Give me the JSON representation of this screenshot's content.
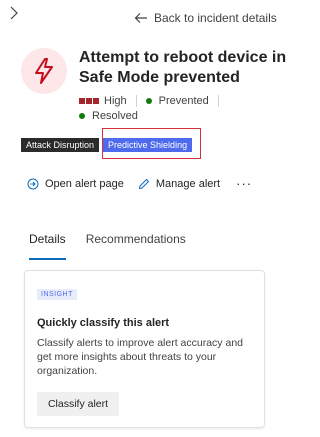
{
  "nav": {
    "back_label": "Back to incident details"
  },
  "alert": {
    "title": "Attempt to reboot device in Safe Mode prevented",
    "severity": "High",
    "status": "Prevented",
    "classification": "Resolved",
    "icon": "bolt-alert-icon"
  },
  "tags": [
    "Attack Disruption",
    "Predictive Shielding"
  ],
  "actions": {
    "open_label": "Open alert page",
    "manage_label": "Manage alert",
    "more_label": "···"
  },
  "tabs": [
    "Details",
    "Recommendations"
  ],
  "insight": {
    "badge": "INSIGHT",
    "title": "Quickly classify this alert",
    "body": "Classify alerts to improve alert accuracy and get more insights about threats to your organization.",
    "button": "Classify alert"
  },
  "colors": {
    "severity": "#a4262c",
    "status_green": "#107c10",
    "accent": "#0f6cbd",
    "tag_blue": "#4f6bed",
    "highlight": "#d13438"
  }
}
